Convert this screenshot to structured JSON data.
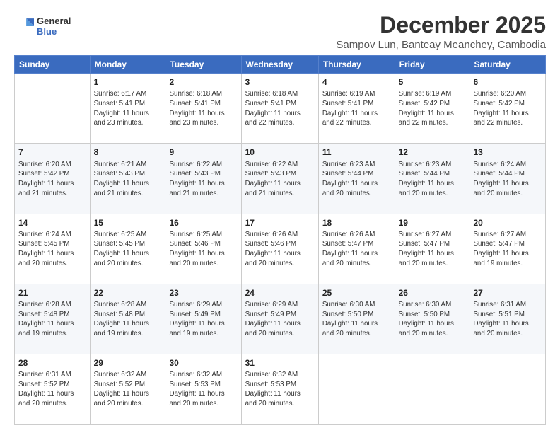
{
  "header": {
    "logo_line1": "General",
    "logo_line2": "Blue",
    "title": "December 2025",
    "subtitle": "Sampov Lun, Banteay Meanchey, Cambodia"
  },
  "columns": [
    "Sunday",
    "Monday",
    "Tuesday",
    "Wednesday",
    "Thursday",
    "Friday",
    "Saturday"
  ],
  "weeks": [
    [
      {
        "num": "",
        "info": ""
      },
      {
        "num": "1",
        "info": "Sunrise: 6:17 AM\nSunset: 5:41 PM\nDaylight: 11 hours\nand 23 minutes."
      },
      {
        "num": "2",
        "info": "Sunrise: 6:18 AM\nSunset: 5:41 PM\nDaylight: 11 hours\nand 23 minutes."
      },
      {
        "num": "3",
        "info": "Sunrise: 6:18 AM\nSunset: 5:41 PM\nDaylight: 11 hours\nand 22 minutes."
      },
      {
        "num": "4",
        "info": "Sunrise: 6:19 AM\nSunset: 5:41 PM\nDaylight: 11 hours\nand 22 minutes."
      },
      {
        "num": "5",
        "info": "Sunrise: 6:19 AM\nSunset: 5:42 PM\nDaylight: 11 hours\nand 22 minutes."
      },
      {
        "num": "6",
        "info": "Sunrise: 6:20 AM\nSunset: 5:42 PM\nDaylight: 11 hours\nand 22 minutes."
      }
    ],
    [
      {
        "num": "7",
        "info": "Sunrise: 6:20 AM\nSunset: 5:42 PM\nDaylight: 11 hours\nand 21 minutes."
      },
      {
        "num": "8",
        "info": "Sunrise: 6:21 AM\nSunset: 5:43 PM\nDaylight: 11 hours\nand 21 minutes."
      },
      {
        "num": "9",
        "info": "Sunrise: 6:22 AM\nSunset: 5:43 PM\nDaylight: 11 hours\nand 21 minutes."
      },
      {
        "num": "10",
        "info": "Sunrise: 6:22 AM\nSunset: 5:43 PM\nDaylight: 11 hours\nand 21 minutes."
      },
      {
        "num": "11",
        "info": "Sunrise: 6:23 AM\nSunset: 5:44 PM\nDaylight: 11 hours\nand 20 minutes."
      },
      {
        "num": "12",
        "info": "Sunrise: 6:23 AM\nSunset: 5:44 PM\nDaylight: 11 hours\nand 20 minutes."
      },
      {
        "num": "13",
        "info": "Sunrise: 6:24 AM\nSunset: 5:44 PM\nDaylight: 11 hours\nand 20 minutes."
      }
    ],
    [
      {
        "num": "14",
        "info": "Sunrise: 6:24 AM\nSunset: 5:45 PM\nDaylight: 11 hours\nand 20 minutes."
      },
      {
        "num": "15",
        "info": "Sunrise: 6:25 AM\nSunset: 5:45 PM\nDaylight: 11 hours\nand 20 minutes."
      },
      {
        "num": "16",
        "info": "Sunrise: 6:25 AM\nSunset: 5:46 PM\nDaylight: 11 hours\nand 20 minutes."
      },
      {
        "num": "17",
        "info": "Sunrise: 6:26 AM\nSunset: 5:46 PM\nDaylight: 11 hours\nand 20 minutes."
      },
      {
        "num": "18",
        "info": "Sunrise: 6:26 AM\nSunset: 5:47 PM\nDaylight: 11 hours\nand 20 minutes."
      },
      {
        "num": "19",
        "info": "Sunrise: 6:27 AM\nSunset: 5:47 PM\nDaylight: 11 hours\nand 20 minutes."
      },
      {
        "num": "20",
        "info": "Sunrise: 6:27 AM\nSunset: 5:47 PM\nDaylight: 11 hours\nand 19 minutes."
      }
    ],
    [
      {
        "num": "21",
        "info": "Sunrise: 6:28 AM\nSunset: 5:48 PM\nDaylight: 11 hours\nand 19 minutes."
      },
      {
        "num": "22",
        "info": "Sunrise: 6:28 AM\nSunset: 5:48 PM\nDaylight: 11 hours\nand 19 minutes."
      },
      {
        "num": "23",
        "info": "Sunrise: 6:29 AM\nSunset: 5:49 PM\nDaylight: 11 hours\nand 19 minutes."
      },
      {
        "num": "24",
        "info": "Sunrise: 6:29 AM\nSunset: 5:49 PM\nDaylight: 11 hours\nand 20 minutes."
      },
      {
        "num": "25",
        "info": "Sunrise: 6:30 AM\nSunset: 5:50 PM\nDaylight: 11 hours\nand 20 minutes."
      },
      {
        "num": "26",
        "info": "Sunrise: 6:30 AM\nSunset: 5:50 PM\nDaylight: 11 hours\nand 20 minutes."
      },
      {
        "num": "27",
        "info": "Sunrise: 6:31 AM\nSunset: 5:51 PM\nDaylight: 11 hours\nand 20 minutes."
      }
    ],
    [
      {
        "num": "28",
        "info": "Sunrise: 6:31 AM\nSunset: 5:52 PM\nDaylight: 11 hours\nand 20 minutes."
      },
      {
        "num": "29",
        "info": "Sunrise: 6:32 AM\nSunset: 5:52 PM\nDaylight: 11 hours\nand 20 minutes."
      },
      {
        "num": "30",
        "info": "Sunrise: 6:32 AM\nSunset: 5:53 PM\nDaylight: 11 hours\nand 20 minutes."
      },
      {
        "num": "31",
        "info": "Sunrise: 6:32 AM\nSunset: 5:53 PM\nDaylight: 11 hours\nand 20 minutes."
      },
      {
        "num": "",
        "info": ""
      },
      {
        "num": "",
        "info": ""
      },
      {
        "num": "",
        "info": ""
      }
    ]
  ]
}
